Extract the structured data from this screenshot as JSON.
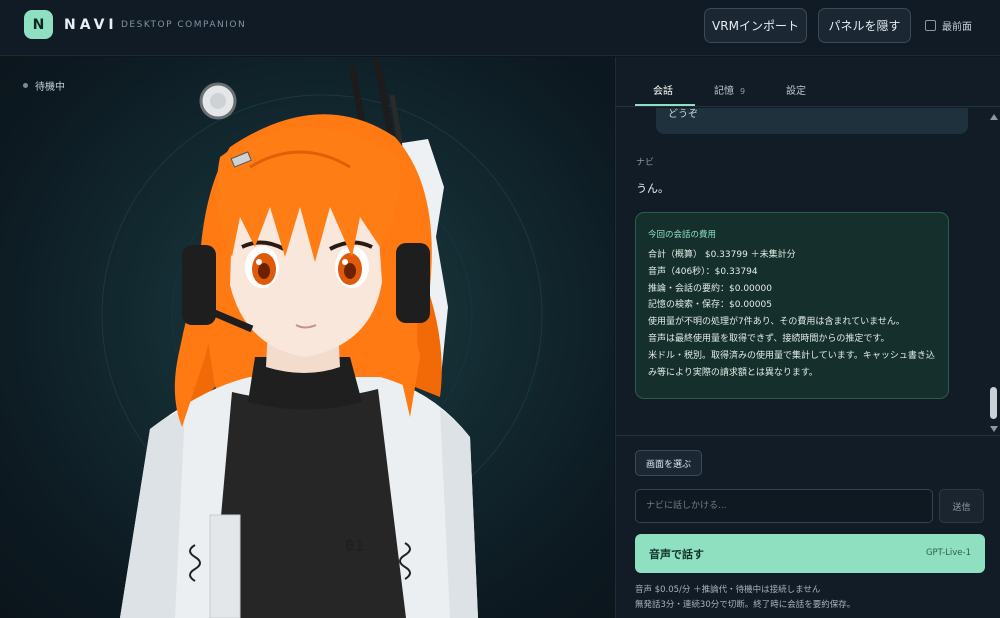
{
  "header": {
    "logo_letter": "N",
    "brand": "NAVI",
    "tagline": "DESKTOP COMPANION",
    "vrm_import": "VRMインポート",
    "hide_panel": "パネルを隠す",
    "always_on_top": "最前面"
  },
  "stage": {
    "status": "待機中",
    "badge_text": "01"
  },
  "tabs": {
    "conversation": "会話",
    "memory": "記憶",
    "memory_count": "9",
    "settings": "設定"
  },
  "chat": {
    "prev_text": "どうぞ",
    "sender": "ナビ",
    "reply": "うん。",
    "cost": {
      "title": "今回の会話の費用",
      "lines": [
        "合計（概算） $0.33799 ＋未集計分",
        "音声（406秒）：$0.33794",
        "推論・会話の要約：$0.00000",
        "記憶の検索・保存：$0.00005",
        "使用量が不明の処理が7件あり、その費用は含まれていません。",
        "音声は最終使用量を取得できず、接続時間からの推定です。",
        "米ドル・税別。取得済みの使用量で集計しています。キャッシュ書き込み等により実際の請求額とは異なります。"
      ]
    }
  },
  "composer": {
    "pick_screen": "画面を選ぶ",
    "input_placeholder": "ナビに話しかける...",
    "send": "送信",
    "voice_label": "音声で話す",
    "voice_model": "GPT-Live-1",
    "note1": "音声 $0.05/分 ＋推論代・待機中は接続しません",
    "note2": "無発話3分・連続30分で切断。終了時に会話を要約保存。"
  },
  "colors": {
    "accent": "#8fe0c1",
    "background": "#0d1620",
    "panel": "#111c26",
    "cost_box": "#15302c",
    "hair": "#ff7a12"
  }
}
